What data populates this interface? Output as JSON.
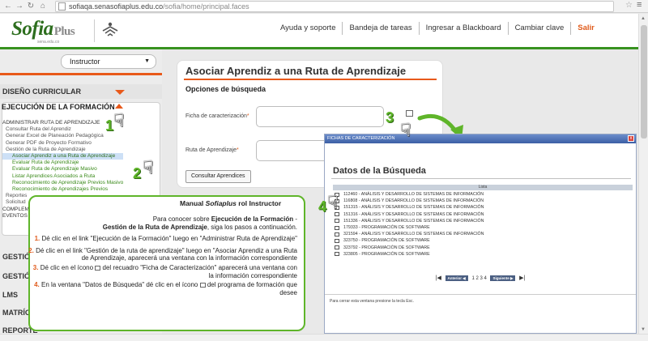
{
  "browser": {
    "url_host": "sofiaqa.senasofiaplus.edu.co",
    "url_path": "/sofia/home/principal.faces"
  },
  "header": {
    "logo_main": "Sofia",
    "logo_plus": "Plus",
    "logo_sub": "sena.edu.co",
    "nav": [
      "Ayuda y soporte",
      "Bandeja de tareas",
      "Ingresar a Blackboard",
      "Cambiar clave",
      "Salir"
    ]
  },
  "sidebar": {
    "role": "Instructor",
    "diseno": "DISEÑO CURRICULAR",
    "ejecucion": "EJECUCIÓN DE LA FORMACIÓN",
    "menu": {
      "group": "ADMINISTRAR RUTA DE APRENDIZAJE",
      "items": [
        "Consultar Ruta del Aprendiz",
        "Generar Excel de Planeación Pedagógica",
        "Generar PDF de Proyecto Formativo",
        "Gestión de la Ruta de Aprendizaje"
      ],
      "subitems": [
        "Asociar Aprendiz a una Ruta de Aprendizaje",
        "Evaluar Ruta de Aprendizaje",
        "Evaluar Ruta de Aprendizaje Masivo",
        "Listar Aprendices Asociados a Ruta",
        "Reconocimiento de Aprendizaje Previos Masivo",
        "Reconocimiento de Aprendizajes Previos"
      ],
      "trailing": [
        "Reportes",
        "Solicitud",
        "COMPLEM",
        "EVENTOS"
      ]
    },
    "lower_sections": [
      "GESTIÓN",
      "GESTIÓN",
      "LMS",
      "MATRÍCU",
      "REPORTE"
    ]
  },
  "main": {
    "title": "Asociar Aprendiz a una Ruta de Aprendizaje",
    "search_options": "Opciones de búsqueda",
    "ficha_label": "Ficha de caracterización",
    "ruta_label": "Ruta de Aprendizaje",
    "required_mark": "*",
    "consult_button": "Consultar Aprendices"
  },
  "steps": [
    "1",
    "2",
    "3",
    "4"
  ],
  "popup": {
    "bar_title": "FICHAS DE CARACTERIZACIÓN",
    "close": "x",
    "title": "Datos de la Búsqueda",
    "list_header": "Lista",
    "rows": [
      "112460 - ANÁLISIS Y DESARROLLO DE SISTEMAS DE INFORMACIÓN",
      "116808 - ANÁLISIS Y DESARROLLO DE SISTEMAS DE INFORMACIÓN",
      "151315 - ANÁLISIS Y DESARROLLO DE SISTEMAS DE INFORMACIÓN",
      "151316 - ANÁLISIS Y DESARROLLO DE SISTEMAS DE INFORMACIÓN",
      "151336 - ANÁLISIS Y DESARROLLO DE SISTEMAS DE INFORMACIÓN",
      "179333 - PROGRAMACIÓN DE SOFTWARE",
      "321594 - ANÁLISIS Y DESARROLLO DE SISTEMAS DE INFORMACIÓN",
      "323750 - PROGRAMACIÓN DE SOFTWARE",
      "323792 - PROGRAMACIÓN DE SOFTWARE",
      "323805 - PROGRAMACIÓN DE SOFTWARE"
    ],
    "pager_prev": "Anterior ◀",
    "pager_pages": "1 2 3 4",
    "pager_next": "Siguiente ▶",
    "footer": "Para cerrar esta ventana presione la tecla Esc."
  },
  "manual": {
    "head_prefix": "Manual ",
    "head_brand": "Sofiaplus",
    "head_suffix": " rol Instructor",
    "intro_a": "Para conocer sobre ",
    "intro_b": "Ejecución de la Formación",
    "intro_c": " -",
    "intro_d": "Gestión de la Ruta de Aprendizaje",
    "intro_e": ", siga los pasos a continuación.",
    "s1_num": "1.",
    "s1": " Dé clic en el link \"Ejecución de la Formación\" luego en \"Administrar Ruta de Aprendizaje\"",
    "s2_num": "2.",
    "s2": " Dé clic en el link \"Gestión de la ruta de aprendizaje\" luego en \"Asociar Aprendiz a una Ruta de Aprendizaje, aparecerá una ventana con la información correspondiente",
    "s3_num": "3.",
    "s3a": " Dé clic en el ícono ",
    "s3b": " del recuadro \"Ficha de Caracterización\" aparecerá una ventana con la información correspondiente",
    "s4_num": "4.",
    "s4a": " En la ventana \"Datos de Búsqueda\" dé clic en el ícono ",
    "s4b": " del programa de formación que desee"
  },
  "colors": {
    "brand_green": "#37921f",
    "accent_orange": "#e8591a",
    "step_green": "#5fb52a",
    "popup_blue": "#3c5fa5"
  },
  "icons": [
    "back-arrow-icon",
    "forward-arrow-icon",
    "reload-icon",
    "home-icon",
    "star-icon",
    "menu-icon",
    "pointing-hand-icon",
    "search-record-icon"
  ]
}
